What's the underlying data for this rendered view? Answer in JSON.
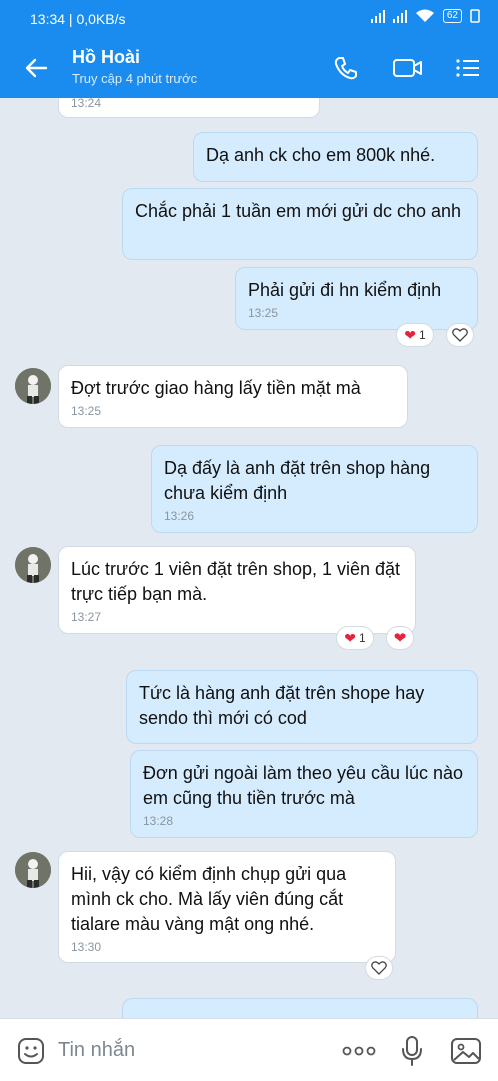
{
  "status_bar": {
    "time": "13:34 | 0,0KB/s",
    "battery": "62"
  },
  "header": {
    "name": "Hồ Hoài",
    "subtitle": "Truy cập 4 phút trước"
  },
  "messages": [
    {
      "side": "in",
      "time": "13:24"
    },
    {
      "side": "out",
      "text": "Dạ anh ck cho em 800k nhé."
    },
    {
      "side": "out",
      "text": "Chắc phải 1 tuần em mới gửi dc cho anh"
    },
    {
      "side": "out",
      "text": "Phải gửi đi hn kiểm định",
      "time": "13:25",
      "reactions": {
        "heart_count": "1",
        "like": "heart-outline"
      }
    },
    {
      "side": "in",
      "text": "Đợt trước giao hàng lấy tiền mặt mà",
      "time": "13:25"
    },
    {
      "side": "out",
      "text": "Dạ đấy là anh đặt trên shop hàng chưa kiểm định",
      "time": "13:26"
    },
    {
      "side": "in",
      "text": "Lúc trước 1 viên đặt trên shop, 1 viên đặt trực tiếp bạn mà.",
      "time": "13:27",
      "reactions": {
        "heart_count": "1",
        "like": "heart-filled"
      }
    },
    {
      "side": "out",
      "text": "Tức  là hàng anh đặt trên shope hay sendo thì mới có cod"
    },
    {
      "side": "out",
      "text": "Đơn gửi ngoài làm theo yêu cầu lúc nào em cũng thu tiền trước mà",
      "time": "13:28"
    },
    {
      "side": "in",
      "text": "Hii, vậy có kiểm định chụp gửi qua mình ck cho. Mà lấy viên đúng cắt tialare màu vàng mật ong nhé.",
      "time": "13:30",
      "reactions": {
        "like": "heart-outline"
      }
    }
  ],
  "composer": {
    "placeholder": "Tin nhắn"
  },
  "colors": {
    "header": "#1a8cf0",
    "background": "#e2e9f0",
    "outgoing_bubble": "#d5ecff",
    "incoming_bubble": "#ffffff",
    "heart": "#e5233d"
  }
}
